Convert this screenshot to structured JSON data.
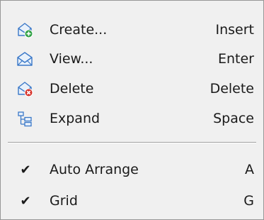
{
  "menu": {
    "items": [
      {
        "label": "Create...",
        "shortcut": "Insert",
        "icon": "envelope-add-icon"
      },
      {
        "label": "View...",
        "shortcut": "Enter",
        "icon": "envelope-view-icon"
      },
      {
        "label": "Delete",
        "shortcut": "Delete",
        "icon": "envelope-delete-icon"
      },
      {
        "label": "Expand",
        "shortcut": "Space",
        "icon": "tree-expand-icon"
      }
    ],
    "toggles": [
      {
        "label": "Auto Arrange",
        "shortcut": "A",
        "checked": true,
        "check_glyph": "✔"
      },
      {
        "label": "Grid",
        "shortcut": "G",
        "checked": true,
        "check_glyph": "✔"
      }
    ]
  },
  "colors": {
    "background": "#f0f0f0",
    "border": "#979797",
    "text": "#1a1a1a",
    "envelope_blue": "#3a78c8",
    "add_green": "#2ea043",
    "delete_red": "#d6332b"
  }
}
